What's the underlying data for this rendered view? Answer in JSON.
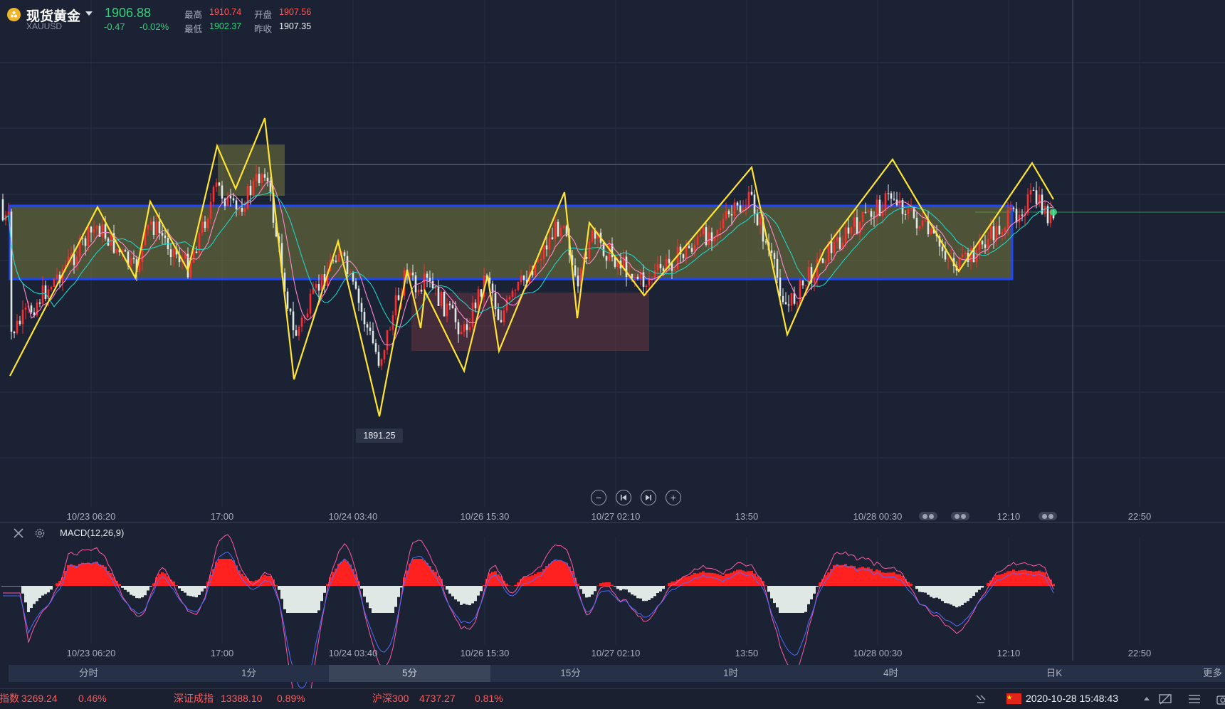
{
  "header": {
    "instrument_name": "现货黄金",
    "symbol": "XAUUSD",
    "last_price": "1906.88",
    "change": "-0.47",
    "change_pct": "-0.02%",
    "high_label": "最高",
    "high_value": "1910.74",
    "open_label": "开盘",
    "open_value": "1907.56",
    "low_label": "最低",
    "low_value": "1902.37",
    "prev_close_label": "昨收",
    "prev_close_value": "1907.35"
  },
  "chart": {
    "low_marker": "1891.25",
    "x_labels": [
      "10/23 06:20",
      "17:00",
      "10/24 03:40",
      "10/26 15:30",
      "10/27 02:10",
      "13:50",
      "10/28 00:30",
      "12:10",
      "22:50"
    ],
    "colors": {
      "background": "#1b2233",
      "zigzag": "#ffe433",
      "range_box": "#1f45ff",
      "up": "#ff2d2d",
      "down": "#dfe8e4",
      "ma_fast": "#ff8ad0",
      "ma_slow": "#1fd3c8"
    }
  },
  "indicator": {
    "name": "MACD(12,26,9)"
  },
  "periods": [
    "分时",
    "1分",
    "5分",
    "15分",
    "1时",
    "4时",
    "日K",
    "更多"
  ],
  "selected_period": "5分",
  "ticker": [
    {
      "name": "指数",
      "value": "3269.24",
      "pct": "0.46%"
    },
    {
      "name": "深证成指",
      "value": "13388.10",
      "pct": "0.89%"
    },
    {
      "name": "沪深300",
      "value": "4737.27",
      "pct": "0.81%"
    }
  ],
  "status": {
    "datetime": "2020-10-28 15:48:43"
  }
}
